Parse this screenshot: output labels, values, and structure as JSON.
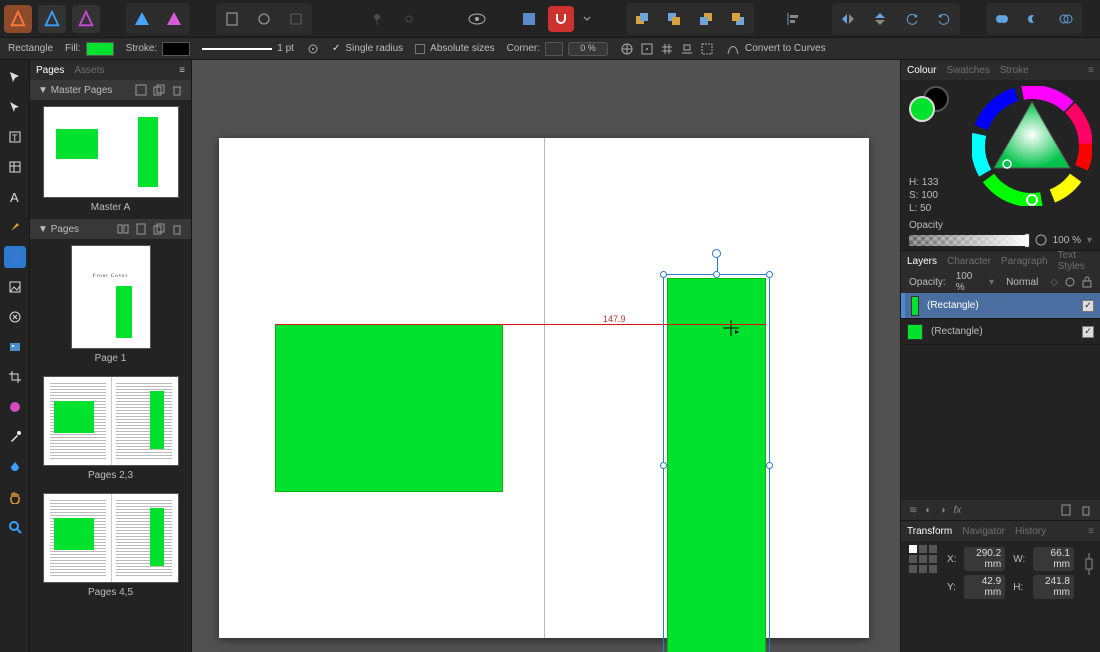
{
  "toolbar": {
    "persona_designer": "Designer",
    "persona_photo": "Photo",
    "magnet_on": true
  },
  "context_bar": {
    "tool_name": "Rectangle",
    "fill_label": "Fill:",
    "fill_color": "#00e22d",
    "stroke_label": "Stroke:",
    "stroke_color": "#000000",
    "stroke_width": "1 pt",
    "single_radius_label": "Single radius",
    "absolute_sizes_label": "Absolute sizes",
    "corner_label": "Corner:",
    "corner_pct": "0 %",
    "convert_label": "Convert to Curves"
  },
  "left_panel": {
    "tab_pages": "Pages",
    "tab_assets": "Assets",
    "section_master": "Master Pages",
    "master_caption": "Master A",
    "section_pages": "Pages",
    "page_thumbs": [
      {
        "caption": "Page 1",
        "cover_text": "Front Cover"
      },
      {
        "caption": "Pages 2,3"
      },
      {
        "caption": "Pages 4,5"
      }
    ]
  },
  "canvas": {
    "measure": "147.9"
  },
  "colour": {
    "tab_colour": "Colour",
    "tab_swatches": "Swatches",
    "tab_stroke": "Stroke",
    "h": "H: 133",
    "s": "S: 100",
    "l": "L: 50",
    "opacity_label": "Opacity",
    "opacity_value": "100 %"
  },
  "layers": {
    "tab_layers": "Layers",
    "tab_character": "Character",
    "tab_paragraph": "Paragraph",
    "tab_textstyles": "Text Styles",
    "opacity_label": "Opacity:",
    "opacity_value": "100 %",
    "blend_mode": "Normal",
    "items": [
      {
        "name": "(Rectangle)",
        "selected": true
      },
      {
        "name": "(Rectangle)",
        "selected": false
      }
    ]
  },
  "transform": {
    "tab_transform": "Transform",
    "tab_navigator": "Navigator",
    "tab_history": "History",
    "x_label": "X:",
    "x_value": "290.2 mm",
    "y_label": "Y:",
    "y_value": "42.9 mm",
    "w_label": "W:",
    "w_value": "66.1 mm",
    "h_label": "H:",
    "h_value": "241.8 mm"
  }
}
